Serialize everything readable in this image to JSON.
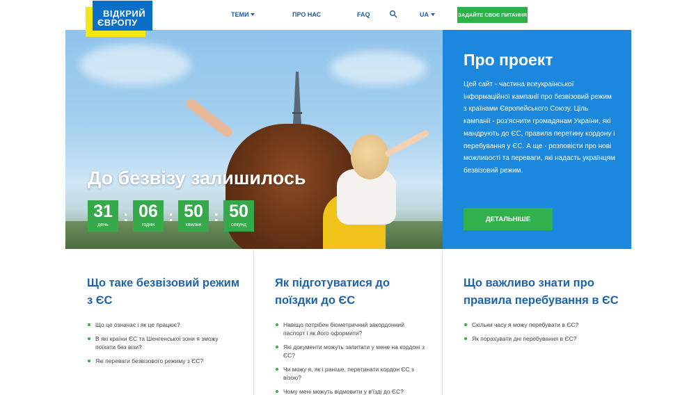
{
  "logo": {
    "line1": "ВІДКРИЙ",
    "line2": "ЄВРОПУ"
  },
  "nav": {
    "themes": "ТЕМИ",
    "about": "ПРО НАС",
    "faq": "FAQ",
    "lang": "UA",
    "ask_button": "ЗАДАЙТЕ СВОЄ ПИТАННЯ",
    "search_icon": "search-icon"
  },
  "hero": {
    "title": "До безвізу залишилось",
    "countdown": [
      {
        "value": "31",
        "label": "день"
      },
      {
        "value": "06",
        "label": "годин"
      },
      {
        "value": "50",
        "label": "хвилин"
      },
      {
        "value": "50",
        "label": "секунд"
      }
    ],
    "separator": ":"
  },
  "about": {
    "title": "Про проект",
    "text": "Цей сайт - частина всеукраїнської інформаційної кампанії про безвізовий режим з країнами Європейського Союзу. Ціль кампанії - роз'яснити громадянам України, які мандрують до ЄС, правила перетину кордону і перебування у ЄС. А ще - розповісти про нові можливості та переваги, які надасть українцям безвізовий режим.",
    "button": "ДЕТАЛЬНІШЕ"
  },
  "columns": [
    {
      "title": "Що таке безвізовий режим з ЄС",
      "items": [
        "Що це означає і як це працює?",
        "В які країни ЄС та Шенгенської зони я зможу поїхати без візи?",
        "Які переваги безвізового режиму з ЄС?"
      ]
    },
    {
      "title": "Як підготуватися до поїздки до ЄС",
      "items": [
        "Навіщо потрібен біометричний закордонний паспорт і як його оформити?",
        "Які документи можуть запитати у мене на кордоні з ЄС?",
        "Чи можу я, як і раніше, перетинати кордон ЄС з візою?",
        "Чому мені можуть відмовити у в'їзді до ЄС?"
      ]
    },
    {
      "title": "Що важливо знати про правила перебування в ЄС",
      "items": [
        "Скільки часу я можу перебувати в ЄС?",
        "Як порахувати дні перебування в ЄС?"
      ]
    }
  ],
  "colors": {
    "brand_blue": "#1b88de",
    "nav_blue": "#1d5fa8",
    "green": "#2fb14a",
    "logo_yellow": "#f5e615"
  }
}
